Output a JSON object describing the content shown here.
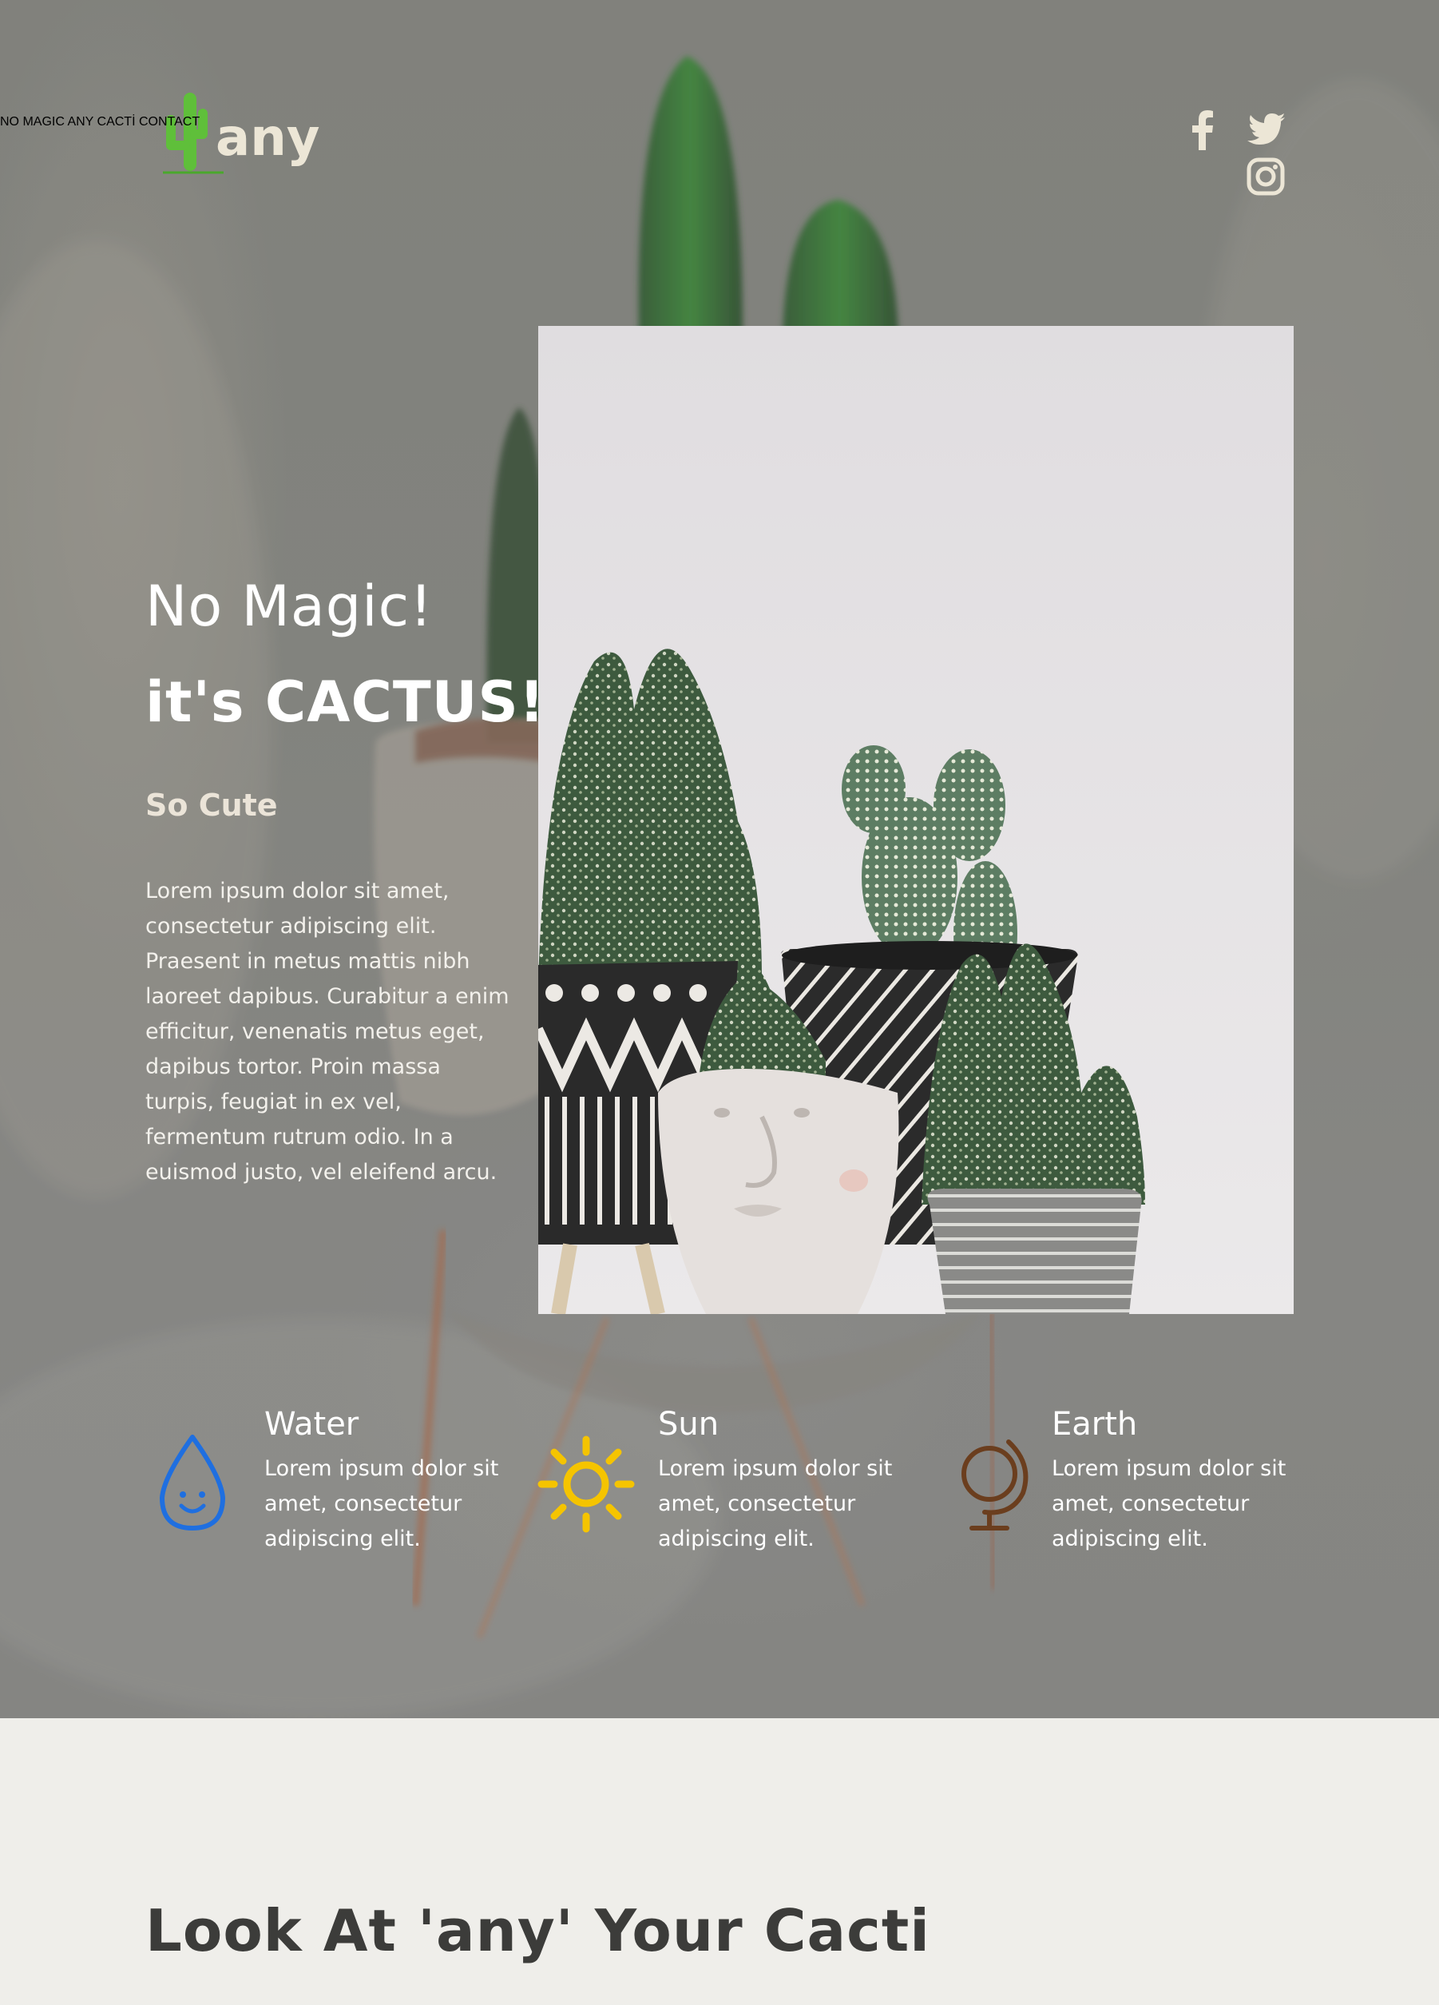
{
  "brand": {
    "logo_text": "any"
  },
  "nav": {
    "items": [
      {
        "label": "NO MAGIC"
      },
      {
        "label": "ANY CACTİ"
      },
      {
        "label": "CONTACT"
      }
    ]
  },
  "social": [
    "facebook-icon",
    "twitter-icon",
    "instagram-icon"
  ],
  "hero": {
    "headline_line1": "No Magic!",
    "headline_line2_prefix": "it's ",
    "headline_line2_bold": "CACTUS!",
    "subtitle": "So Cute",
    "intro": "Lorem ipsum dolor sit amet, consectetur adipiscing elit. Praesent in metus mattis nibh laoreet dapibus. Curabitur a enim efficitur, venenatis metus eget, dapibus tortor. Proin massa turpis, feugiat in ex vel, fermentum rutrum odio. In a euismod justo, vel eleifend arcu."
  },
  "features": [
    {
      "icon": "water-drop-icon",
      "title": "Water",
      "text": "Lorem ipsum dolor sit amet, consectetur adipiscing elit."
    },
    {
      "icon": "sun-icon",
      "title": "Sun",
      "text": "Lorem ipsum dolor sit amet, consectetur adipiscing elit."
    },
    {
      "icon": "globe-icon",
      "title": "Earth",
      "text": "Lorem ipsum dolor sit amet, consectetur adipiscing elit."
    }
  ],
  "section": {
    "title": "Look At 'any' Your Cacti"
  },
  "colors": {
    "logo_green": "#5fbf3a",
    "logo_cream": "#ece6d6",
    "water_blue": "#1f6fe0",
    "sun_yellow": "#f5c400",
    "earth_brown": "#6b3e1e",
    "section_bg": "#efeeea"
  }
}
